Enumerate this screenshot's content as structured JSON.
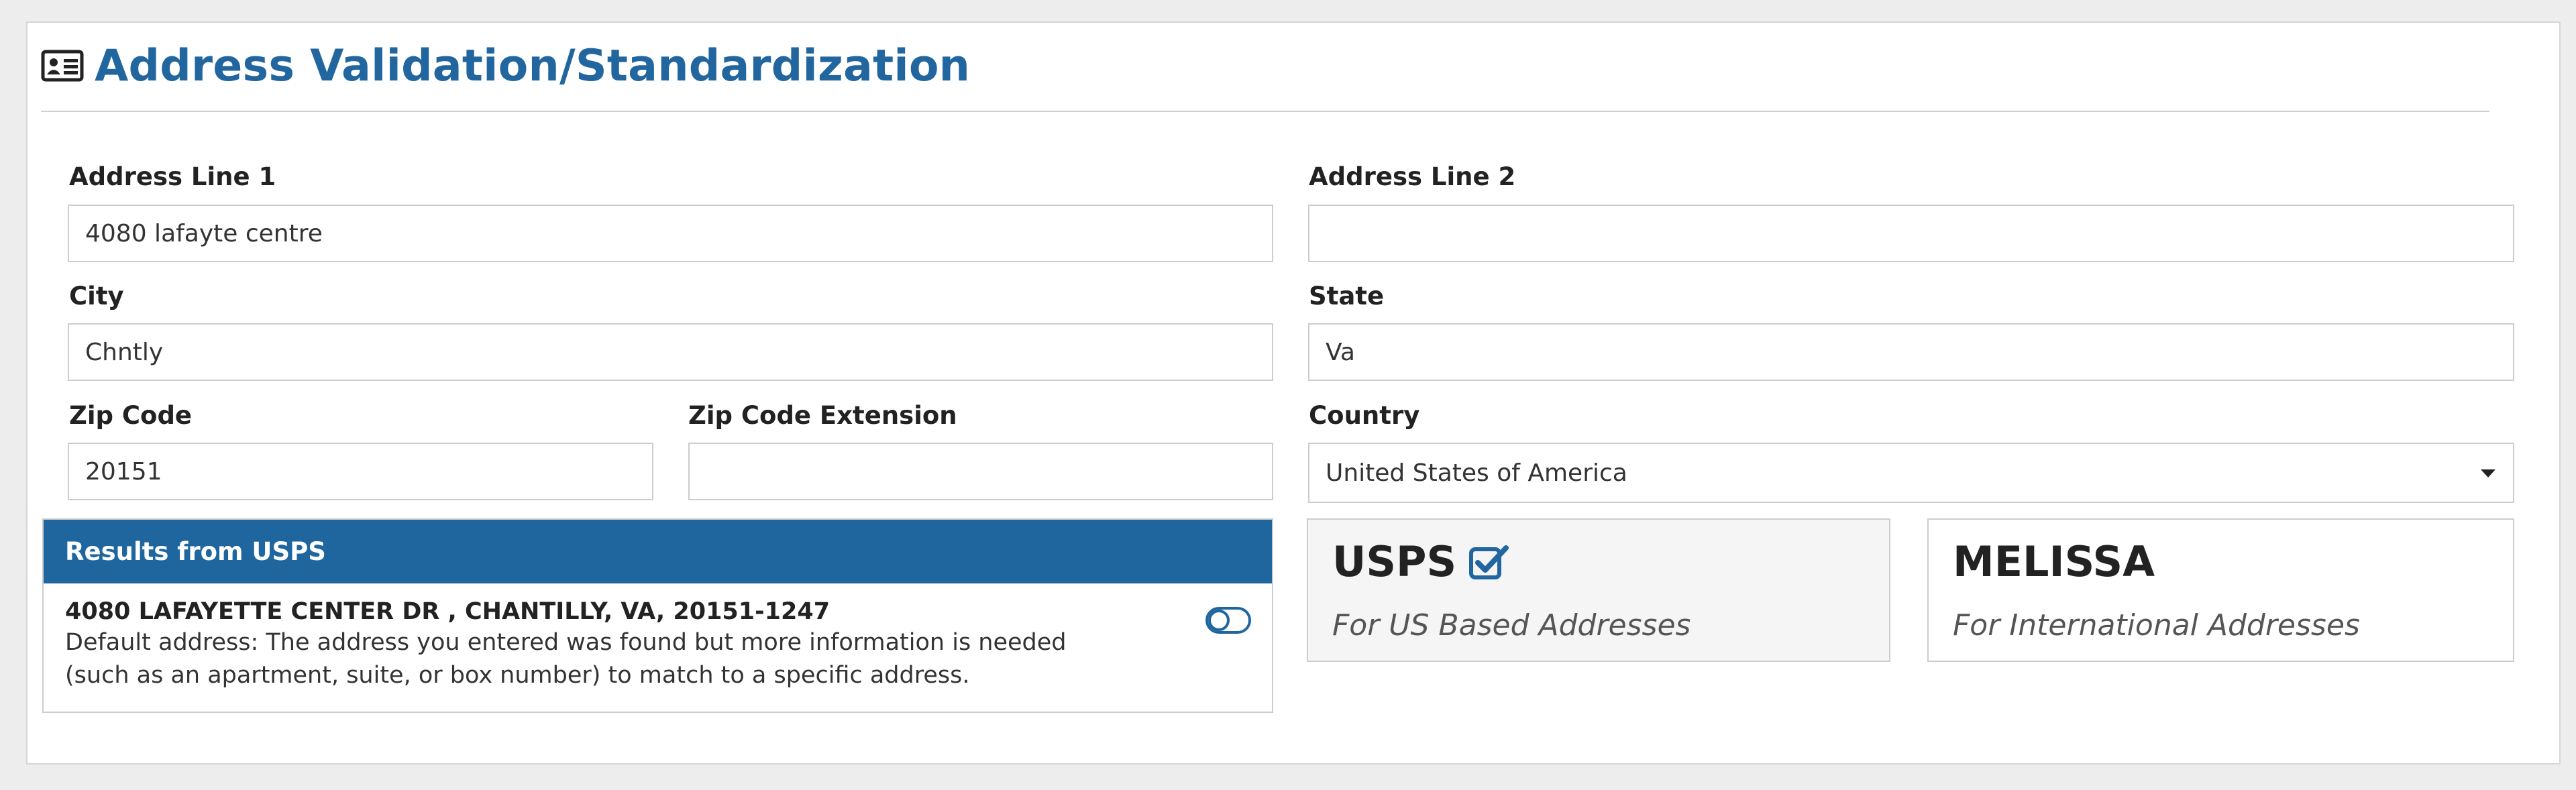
{
  "page": {
    "title": "Address Validation/Standardization",
    "icon": "address-card-icon"
  },
  "form": {
    "address_line_1": {
      "label": "Address Line 1",
      "value": "4080 lafayte centre"
    },
    "address_line_2": {
      "label": "Address Line 2",
      "value": ""
    },
    "city": {
      "label": "City",
      "value": "Chntly"
    },
    "state": {
      "label": "State",
      "value": "Va"
    },
    "zip_code": {
      "label": "Zip Code",
      "value": "20151"
    },
    "zip_code_extension": {
      "label": "Zip Code Extension",
      "value": ""
    },
    "country": {
      "label": "Country",
      "value": "United States of America"
    }
  },
  "results": {
    "header": "Results from USPS",
    "address": "4080 LAFAYETTE CENTER DR , CHANTILLY, VA, 20151-1247",
    "message": "Default address: The address you entered was found but more information is needed (such as an apartment, suite, or box number) to match to a specific address.",
    "toggle_icon": "toggle-off-icon"
  },
  "providers": {
    "usps": {
      "name": "USPS",
      "description": "For US Based Addresses",
      "selected": true,
      "check_icon": "check-square-icon"
    },
    "melissa": {
      "name": "MELISSA",
      "description": "For International Addresses",
      "selected": false
    }
  },
  "colors": {
    "accent": "#2266a0",
    "results_header_bg": "#1f669f",
    "page_bg": "#ededed"
  }
}
